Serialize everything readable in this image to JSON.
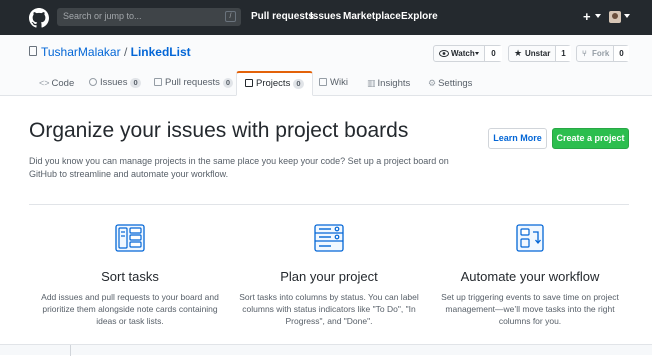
{
  "topnav": {
    "search_placeholder": "Search or jump to...",
    "search_key": "/",
    "links": [
      "Pull requests",
      "Issues",
      "Marketplace",
      "Explore"
    ],
    "plus": "+"
  },
  "repo": {
    "owner": "TusharMalakar",
    "separator": "/",
    "name": "LinkedList",
    "watch_label": "Watch",
    "watch_count": "0",
    "unstar_label": "Unstar",
    "star_count": "1",
    "fork_label": "Fork",
    "fork_count": "0"
  },
  "tabs": [
    {
      "label": "Code"
    },
    {
      "label": "Issues",
      "count": "0"
    },
    {
      "label": "Pull requests",
      "count": "0"
    },
    {
      "label": "Projects",
      "count": "0"
    },
    {
      "label": "Wiki"
    },
    {
      "label": "Insights"
    },
    {
      "label": "Settings"
    }
  ],
  "hero": {
    "title": "Organize your issues with project boards",
    "description": "Did you know you can manage projects in the same place you keep your code? Set up a project board on GitHub to streamline and automate your workflow.",
    "learn_more": "Learn More",
    "create_project": "Create a project"
  },
  "features": [
    {
      "title": "Sort tasks",
      "text": "Add issues and pull requests to your board and prioritize them alongside note cards containing ideas or task lists."
    },
    {
      "title": "Plan your project",
      "text": "Sort tasks into columns by status. You can label columns with status indicators like \"To Do\", \"In Progress\", and \"Done\"."
    },
    {
      "title": "Automate your workflow",
      "text": "Set up triggering events to save time on project management—we’ll move tasks into the right columns for you."
    }
  ],
  "colors": {
    "topbar": "#24292e",
    "link": "#0366d6",
    "green": "#2cbe4e",
    "active_tab_accent": "#e36209",
    "icon_blue": "#0366d6"
  }
}
